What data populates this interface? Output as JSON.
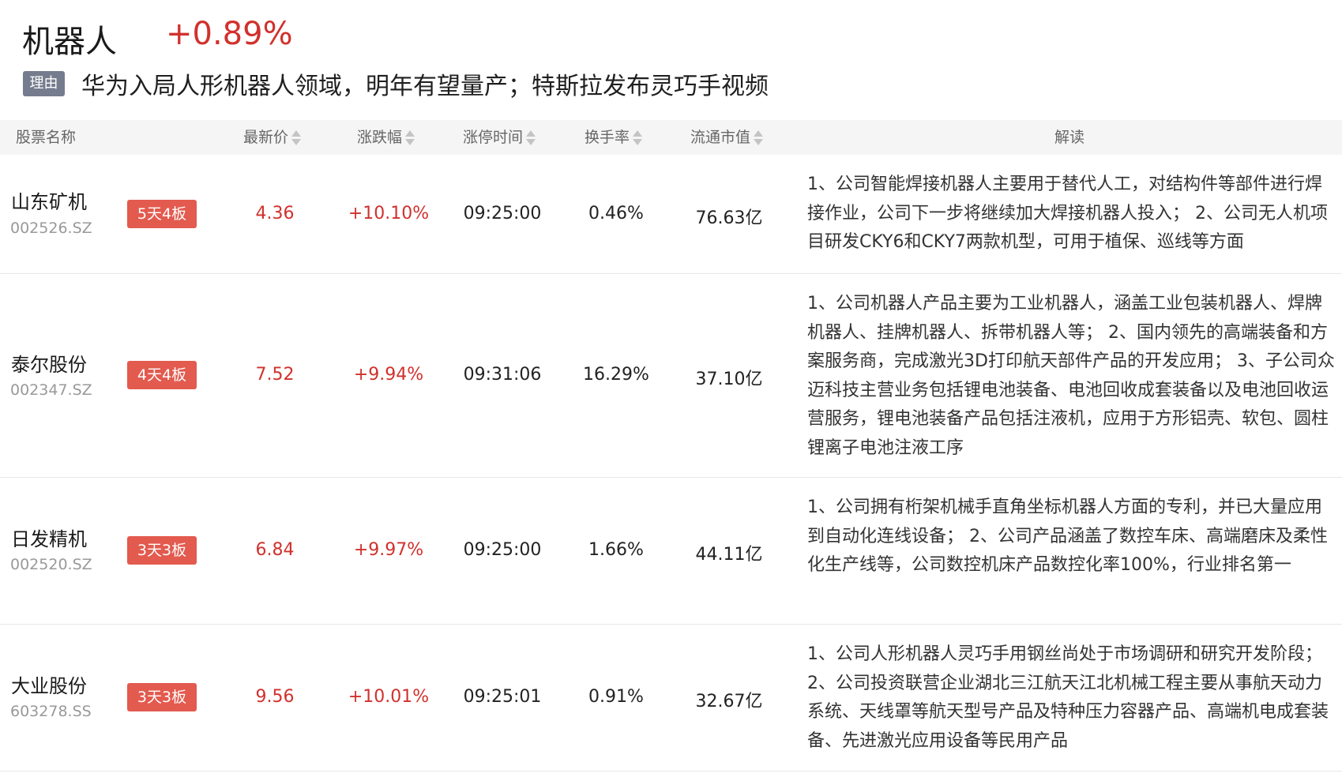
{
  "header": {
    "title": "机器人",
    "change": "+0.89%",
    "reason_tag": "理由",
    "reason_text": "华为入局人形机器人领域，明年有望量产；特斯拉发布灵巧手视频"
  },
  "table": {
    "columns": {
      "name": "股票名称",
      "price": "最新价",
      "change": "涨跌幅",
      "limit_time": "涨停时间",
      "turnover": "换手率",
      "market_cap": "流通市值",
      "analysis": "解读"
    },
    "rows": [
      {
        "name": "山东矿机",
        "code": "002526.SZ",
        "badge": "5天4板",
        "price": "4.36",
        "change": "+10.10%",
        "limit_time": "09:25:00",
        "turnover": "0.46%",
        "market_cap": "76.63亿",
        "analysis": "1、公司智能焊接机器人主要用于替代人工，对结构件等部件进行焊接作业，公司下一步将继续加大焊接机器人投入； 2、公司无人机项目研发CKY6和CKY7两款机型，可用于植保、巡线等方面"
      },
      {
        "name": "泰尔股份",
        "code": "002347.SZ",
        "badge": "4天4板",
        "price": "7.52",
        "change": "+9.94%",
        "limit_time": "09:31:06",
        "turnover": "16.29%",
        "market_cap": "37.10亿",
        "analysis": "1、公司机器人产品主要为工业机器人，涵盖工业包装机器人、焊牌机器人、挂牌机器人、拆带机器人等； 2、国内领先的高端装备和方案服务商，完成激光3D打印航天部件产品的开发应用； 3、子公司众迈科技主营业务包括锂电池装备、电池回收成套装备以及电池回收运营服务，锂电池装备产品包括注液机，应用于方形铝壳、软包、圆柱锂离子电池注液工序"
      },
      {
        "name": "日发精机",
        "code": "002520.SZ",
        "badge": "3天3板",
        "price": "6.84",
        "change": "+9.97%",
        "limit_time": "09:25:00",
        "turnover": "1.66%",
        "market_cap": "44.11亿",
        "analysis": "1、公司拥有桁架机械手直角坐标机器人方面的专利，并已大量应用到自动化连线设备； 2、公司产品涵盖了数控车床、高端磨床及柔性化生产线等，公司数控机床产品数控化率100%，行业排名第一"
      },
      {
        "name": "大业股份",
        "code": "603278.SS",
        "badge": "3天3板",
        "price": "9.56",
        "change": "+10.01%",
        "limit_time": "09:25:01",
        "turnover": "0.91%",
        "market_cap": "32.67亿",
        "analysis": "1、公司人形机器人灵巧手用钢丝尚处于市场调研和研究开发阶段； 2、公司投资联营企业湖北三江航天江北机械工程主要从事航天动力系统、天线罩等航天型号产品及特种压力容器产品、高端机电成套装备、先进激光应用设备等民用产品"
      }
    ]
  },
  "colors": {
    "up_red": "#d1312c",
    "badge_red": "#e35a4e",
    "tag_gray": "#757c8e"
  }
}
